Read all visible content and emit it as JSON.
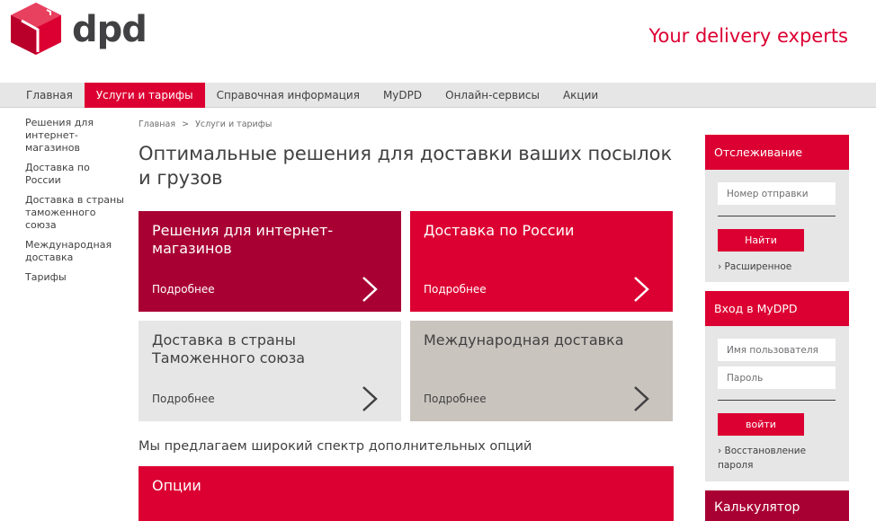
{
  "header": {
    "logo_text": "dpd",
    "tagline": "Your delivery experts",
    "brand_color": "#dc0032",
    "brand_dark": "#a90034"
  },
  "nav": {
    "items": [
      {
        "label": "Главная"
      },
      {
        "label": "Услуги и тарифы",
        "active": true
      },
      {
        "label": "Справочная информация"
      },
      {
        "label": "MyDPD"
      },
      {
        "label": "Онлайн-сервисы"
      },
      {
        "label": "Акции"
      }
    ]
  },
  "sidebar": {
    "items": [
      {
        "label": "Решения для интернет-магазинов"
      },
      {
        "label": "Доставка по России"
      },
      {
        "label": "Доставка в страны таможенного союза"
      },
      {
        "label": "Международная доставка"
      },
      {
        "label": "Тарифы"
      }
    ]
  },
  "breadcrumb": {
    "home": "Главная",
    "separator": ">",
    "current": "Услуги и тарифы"
  },
  "main": {
    "title": "Оптимальные решения для доставки ваших посылок и грузов",
    "tiles": [
      {
        "title": "Решения для интернет-магазинов",
        "more": "Подробнее"
      },
      {
        "title": "Доставка по России",
        "more": "Подробнее"
      },
      {
        "title": "Доставка в страны Таможенного союза",
        "more": "Подробнее"
      },
      {
        "title": "Международная доставка",
        "more": "Подробнее"
      }
    ],
    "offer_text": "Мы предлагаем широкий спектр дополнительных опций",
    "options_title": "Опции"
  },
  "tracking": {
    "title": "Отслеживание",
    "placeholder": "Номер отправки",
    "button": "Найти",
    "link": "Расширенное"
  },
  "login": {
    "title": "Вход в MyDPD",
    "username_placeholder": "Имя пользователя",
    "password_placeholder": "Пароль",
    "button": "войти",
    "link": "Восстановление пароля"
  },
  "calculator": {
    "title": "Калькулятор"
  }
}
